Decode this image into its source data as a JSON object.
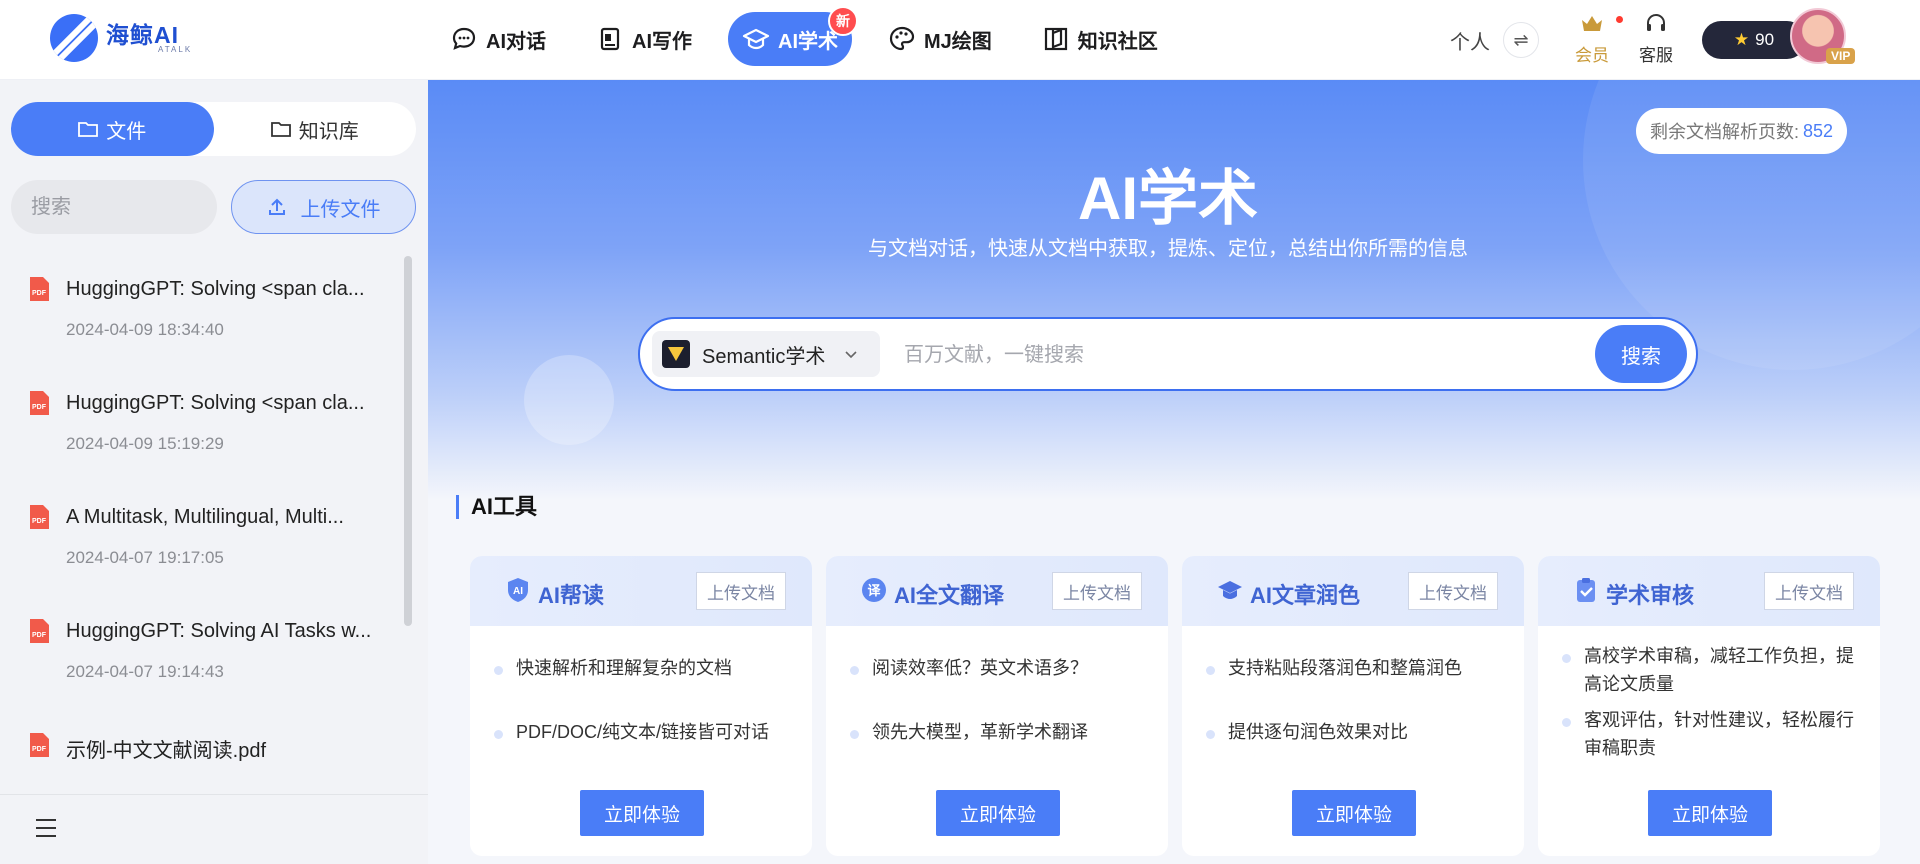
{
  "brand": {
    "name": "海鲸AI",
    "sub": "ATALK"
  },
  "nav": {
    "items": [
      {
        "label": "AI对话",
        "icon": "chat-icon"
      },
      {
        "label": "AI写作",
        "icon": "writing-icon"
      },
      {
        "label": "AI学术",
        "icon": "academic-cap-icon",
        "active": true,
        "badge": "新"
      },
      {
        "label": "MJ绘图",
        "icon": "palette-icon"
      },
      {
        "label": "知识社区",
        "icon": "book-icon"
      }
    ]
  },
  "user": {
    "personal_label": "个人",
    "member_label": "会员",
    "service_label": "客服",
    "points": "90",
    "vip_label": "VIP"
  },
  "sidebar": {
    "tabs": [
      {
        "label": "文件",
        "active": true
      },
      {
        "label": "知识库"
      }
    ],
    "search_placeholder": "搜索",
    "upload_label": "上传文件",
    "files": [
      {
        "name": "HuggingGPT: Solving <span cla...",
        "time": "2024-04-09 18:34:40"
      },
      {
        "name": "HuggingGPT: Solving <span cla...",
        "time": "2024-04-09 15:19:29"
      },
      {
        "name": "A Multitask, Multilingual, Multi...",
        "time": "2024-04-07 19:17:05"
      },
      {
        "name": "HuggingGPT: Solving AI Tasks w...",
        "time": "2024-04-07 19:14:43"
      },
      {
        "name": "示例-中文文献阅读.pdf",
        "time": ""
      }
    ]
  },
  "hero": {
    "remaining_label": "剩余文档解析页数:",
    "remaining_count": "852",
    "title": "AI学术",
    "subtitle": "与文档对话，快速从文档中获取，提炼、定位，总结出你所需的信息",
    "engine": "Semantic学术",
    "search_placeholder": "百万文献，一键搜索",
    "search_button": "搜索"
  },
  "tools": {
    "section_title": "AI工具",
    "cards": [
      {
        "title": "AI帮读",
        "upload": "上传文档",
        "bullets": [
          "快速解析和理解复杂的文档",
          "PDF/DOC/纯文本/链接皆可对话"
        ],
        "button": "立即体验"
      },
      {
        "title": "AI全文翻译",
        "upload": "上传文档",
        "bullets": [
          "阅读效率低？英文术语多？",
          "领先大模型，革新学术翻译"
        ],
        "button": "立即体验"
      },
      {
        "title": "AI文章润色",
        "upload": "上传文档",
        "bullets": [
          "支持粘贴段落润色和整篇润色",
          "提供逐句润色效果对比"
        ],
        "button": "立即体验"
      },
      {
        "title": "学术审核",
        "upload": "上传文档",
        "bullets": [
          "高校学术审稿，减轻工作负担，提高论文质量",
          "客观评估，针对性建议，轻松履行审稿职责"
        ],
        "button": "立即体验"
      }
    ]
  },
  "colors": {
    "accent": "#4a7df7",
    "points_bg": "#24273a",
    "member": "#c99a3a",
    "badge": "#ff4d4f"
  }
}
